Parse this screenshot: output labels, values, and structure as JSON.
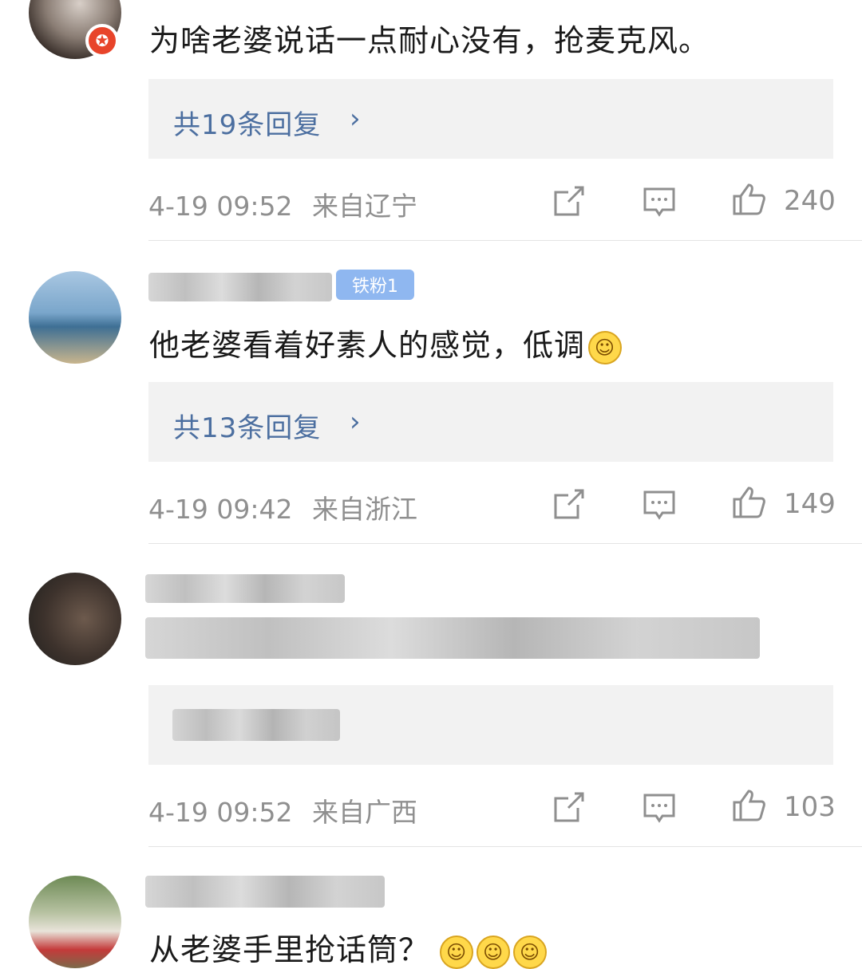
{
  "comments": [
    {
      "text": "为啥老婆说话一点耐心没有，抢麦克风。",
      "reply_count": "共19条回复",
      "time": "4-19 09:52",
      "location": "来自辽宁",
      "likes": "240"
    },
    {
      "text": "他老婆看着好素人的感觉，低调",
      "reply_count": "共13条回复",
      "time": "4-19 09:42",
      "location": "来自浙江",
      "likes": "149",
      "badge": "铁粉1"
    },
    {
      "time": "4-19 09:52",
      "location": "来自广西",
      "likes": "103"
    },
    {
      "text": "从老婆手里抢话筒？"
    }
  ],
  "icons": {
    "share": "share-icon",
    "comment": "comment-icon",
    "like": "thumbs-up-icon",
    "chevron": "chevron-right-icon"
  },
  "colors": {
    "reply_link": "#4c6fa0",
    "meta_gray": "#8f8f8f",
    "reply_box_bg": "#f2f2f2"
  }
}
